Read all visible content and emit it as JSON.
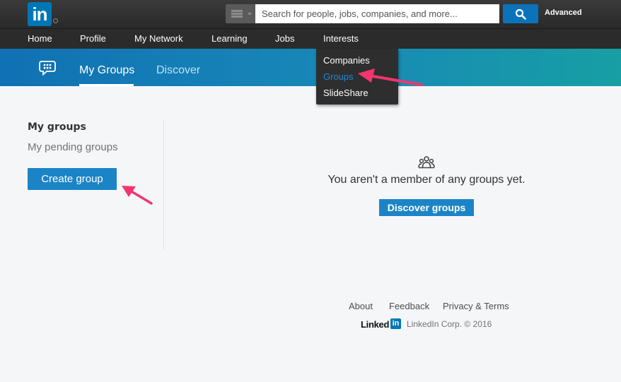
{
  "topbar": {
    "logo_text": "in",
    "search_placeholder": "Search for people, jobs, companies, and more...",
    "advanced_label": "Advanced"
  },
  "nav": {
    "items": [
      "Home",
      "Profile",
      "My Network",
      "Learning",
      "Jobs",
      "Interests"
    ]
  },
  "interests_dropdown": {
    "items": [
      "Companies",
      "Groups",
      "SlideShare"
    ],
    "active_index": 1
  },
  "groups_header": {
    "tabs": [
      "My Groups",
      "Discover"
    ],
    "active_tab": "My Groups"
  },
  "sidebar": {
    "title": "My groups",
    "pending_link": "My pending groups",
    "create_button": "Create group"
  },
  "main": {
    "empty_message": "You aren't a member of any groups yet.",
    "discover_button": "Discover groups"
  },
  "footer": {
    "links": [
      "About",
      "Feedback",
      "Privacy & Terms"
    ],
    "logo_word": "Linked",
    "logo_box": "in",
    "copyright": "LinkedIn Corp. © 2016"
  },
  "colors": {
    "brand_blue": "#0077b5",
    "button_blue": "#1b84c6",
    "annotation_arrow": "#f0356f"
  }
}
